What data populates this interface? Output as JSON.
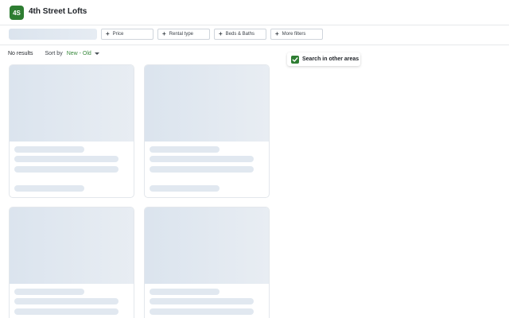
{
  "header": {
    "logo_text": "4S",
    "title": "4th Street Lofts"
  },
  "filters": [
    {
      "label": "Price"
    },
    {
      "label": "Rental type"
    },
    {
      "label": "Beds & Baths"
    },
    {
      "label": "More filters"
    }
  ],
  "results": {
    "count_text": "No results",
    "sort_label": "Sort by",
    "sort_value": "New - Old"
  },
  "search_other_areas": {
    "label": "Search in other areas",
    "checked": true
  },
  "colors": {
    "brand": "#2e7d32",
    "accent": "#3a8a3e",
    "skeleton": "#e1e8f0"
  }
}
